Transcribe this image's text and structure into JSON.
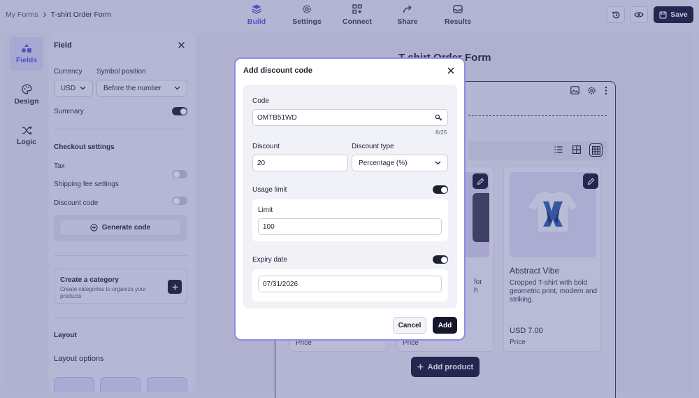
{
  "breadcrumb": {
    "root": "My Forms",
    "current": "T-shirt Order Form"
  },
  "nav": {
    "build": "Build",
    "settings": "Settings",
    "connect": "Connect",
    "share": "Share",
    "results": "Results"
  },
  "toolbar": {
    "save_label": "Save"
  },
  "rail": {
    "fields": "Fields",
    "design": "Design",
    "logic": "Logic"
  },
  "panel": {
    "title": "Field",
    "currency_label": "Currency",
    "currency_value": "USD",
    "symbol_label": "Symbol position",
    "symbol_value": "Before the number",
    "summary_label": "Summary",
    "checkout_title": "Checkout settings",
    "tax_label": "Tax",
    "shipping_label": "Shipping fee settings",
    "discount_label": "Discount code",
    "generate_label": "Generate code",
    "category_title": "Create a category",
    "category_desc": "Create categories to organize your products",
    "layout_title": "Layout",
    "layout_options": "Layout options"
  },
  "form": {
    "title": "T-shirt Order Form",
    "product_name": "Abstract Vibe",
    "product_desc": "Cropped T-shirt with bold geometric print, modern and striking.",
    "product_price": "USD 7.00",
    "price_label": "Price",
    "partial_desc_1": "for",
    "partial_desc_2": "h",
    "add_product": "Add product"
  },
  "modal": {
    "title": "Add discount code",
    "code_label": "Code",
    "code_value": "OMTB51WD",
    "code_counter": "8/25",
    "discount_label": "Discount",
    "discount_value": "20",
    "discount_type_label": "Discount type",
    "discount_type_value": "Percentage (%)",
    "usage_limit_label": "Usage limit",
    "limit_label": "Limit",
    "limit_value": "100",
    "expiry_label": "Expiry date",
    "expiry_value": "07/31/2026",
    "cancel": "Cancel",
    "add": "Add"
  },
  "colors": {
    "accent": "#5a56d6",
    "dark": "#16172d",
    "modal_border": "#8e8ae6"
  }
}
